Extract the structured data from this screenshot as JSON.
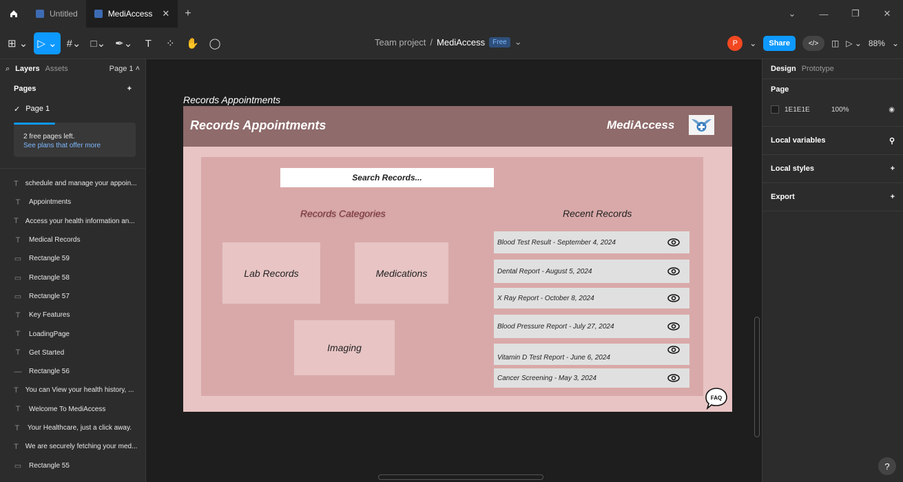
{
  "tabs": [
    {
      "label": "Untitled",
      "active": false
    },
    {
      "label": "MediAccess",
      "active": true
    }
  ],
  "toolbar": {
    "breadcrumb_team": "Team project",
    "breadcrumb_sep": "/",
    "breadcrumb_project": "MediAccess",
    "plan_badge": "Free",
    "avatar_initial": "P",
    "share_label": "Share",
    "zoom": "88%"
  },
  "left_panel": {
    "tab_layers": "Layers",
    "tab_assets": "Assets",
    "page_selector": "Page 1",
    "pages_header": "Pages",
    "pages": [
      "Page 1"
    ],
    "upsell_text": "2 free pages left.",
    "upsell_link": "See plans that offer more",
    "layers": [
      {
        "icon": "text",
        "label": "schedule and manage your appoin..."
      },
      {
        "icon": "text",
        "label": "Appointments"
      },
      {
        "icon": "text",
        "label": "Access your health information an..."
      },
      {
        "icon": "text",
        "label": "Medical Records"
      },
      {
        "icon": "rectangle",
        "label": "Rectangle 59"
      },
      {
        "icon": "rectangle",
        "label": "Rectangle 58"
      },
      {
        "icon": "rectangle",
        "label": "Rectangle 57"
      },
      {
        "icon": "text",
        "label": "Key Features"
      },
      {
        "icon": "text",
        "label": "LoadingPage"
      },
      {
        "icon": "text",
        "label": "Get Started"
      },
      {
        "icon": "line",
        "label": "Rectangle 56"
      },
      {
        "icon": "text",
        "label": "You can View your health history, ..."
      },
      {
        "icon": "text",
        "label": "Welcome To MediAccess"
      },
      {
        "icon": "text",
        "label": "Your Healthcare, just a click away."
      },
      {
        "icon": "text",
        "label": "We are securely fetching your med..."
      },
      {
        "icon": "rectangle",
        "label": "Rectangle 55"
      }
    ]
  },
  "right_panel": {
    "tab_design": "Design",
    "tab_prototype": "Prototype",
    "page_section": "Page",
    "bg_color": "1E1E1E",
    "bg_opacity": "100%",
    "local_variables": "Local variables",
    "local_styles": "Local styles",
    "export": "Export"
  },
  "canvas": {
    "frame_label": "Records Appointments",
    "header_title": "Records Appointments",
    "brand": "MediAccess",
    "search_placeholder": "Search Records...",
    "categories_title": "Records Categories",
    "recent_title": "Recent Records",
    "categories": [
      "Lab Records",
      "Medications",
      "Imaging"
    ],
    "recent_records": [
      "Blood Test Result - September 4, 2024",
      "Dental Report - August 5, 2024",
      "X Ray Report - October 8, 2024",
      "Blood Pressure Report - July 27, 2024",
      "Vitamin D Test  Report - June 6, 2024",
      "Cancer Screening - May 3, 2024"
    ],
    "faq": "FAQ"
  },
  "colors": {
    "accent": "#0d99ff",
    "header_bar": "#8f6b6b",
    "frame_bg": "#e8c4c4",
    "inner_bg": "#d9a9a9",
    "category_title": "#7a2f38"
  }
}
